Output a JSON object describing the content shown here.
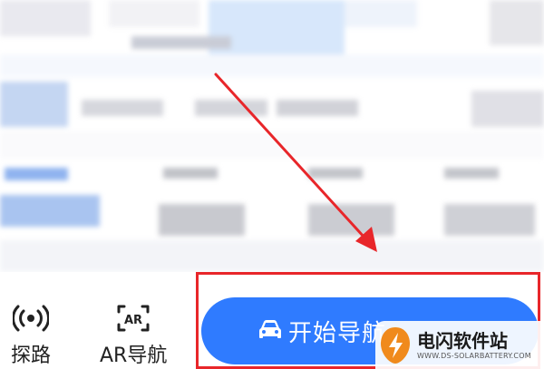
{
  "toolbar": {
    "explore": {
      "label": "探路",
      "icon": "signal-broadcast-icon"
    },
    "ar": {
      "label": "AR导航",
      "icon": "ar-scan-icon",
      "icon_text": "AR"
    },
    "start_button": {
      "label": "开始导航",
      "icon": "car-icon"
    }
  },
  "watermark": {
    "title": "电闪软件站",
    "subtitle": "WWW.DS-SOLARBATTERY.COM"
  },
  "colors": {
    "primary": "#2f7bff",
    "annotation_red": "#e8262a",
    "watermark_orange": "#f08a1c"
  }
}
